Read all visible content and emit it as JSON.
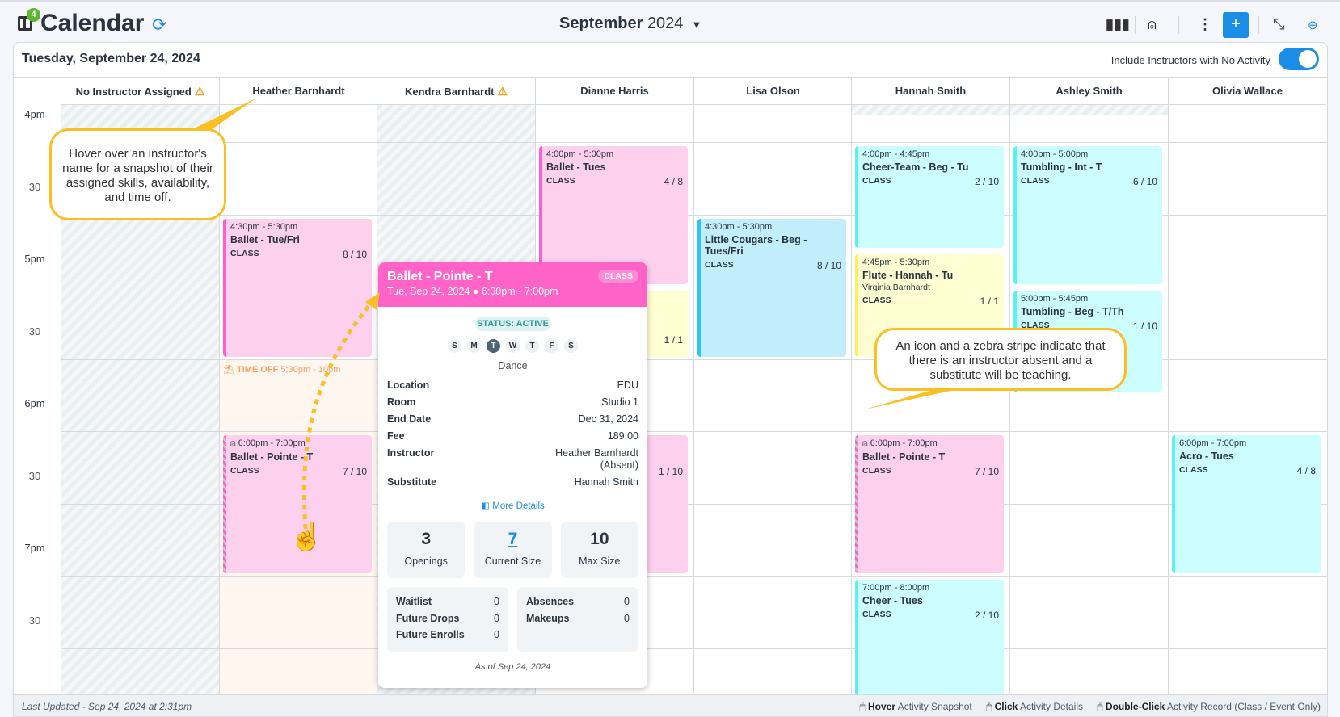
{
  "header": {
    "title": "Calendar",
    "notification_count": "4",
    "month_bold": "September",
    "month_year": "2024"
  },
  "panel": {
    "date": "Tuesday, September 24, 2024",
    "toggle_label": "Include Instructors with No Activity",
    "toggle_on": true
  },
  "instructors": [
    {
      "name": "No Instructor Assigned",
      "warning": true,
      "unavailable": true
    },
    {
      "name": "Heather Barnhardt",
      "warning": false
    },
    {
      "name": "Kendra Barnhardt",
      "warning": true,
      "unavailable": true
    },
    {
      "name": "Dianne Harris",
      "warning": false
    },
    {
      "name": "Lisa Olson",
      "warning": false
    },
    {
      "name": "Hannah Smith",
      "warning": false
    },
    {
      "name": "Ashley Smith",
      "warning": false
    },
    {
      "name": "Olivia Wallace",
      "warning": false
    }
  ],
  "time_labels": [
    "4pm",
    "30",
    "5pm",
    "30",
    "6pm",
    "30",
    "7pm",
    "30"
  ],
  "time_off": {
    "instructor": 1,
    "label": "TIME OFF",
    "time": "5:30pm - 10pm",
    "start": 17.5,
    "end": 22
  },
  "colors": {
    "pink": "#ff5fc8",
    "cyan": "#5cf0f5",
    "yellow": "#ffef5a",
    "blue": "#2cc3f7",
    "accent": "#1a8de6",
    "warning": "#f59a0b"
  },
  "events": [
    {
      "col": 1,
      "start": 16.5,
      "end": 17.5,
      "time": "4:30pm - 5:30pm",
      "name": "Ballet - Tue/Fri",
      "type": "CLASS",
      "count": "8 / 10",
      "color": "pink"
    },
    {
      "col": 1,
      "start": 18,
      "end": 19,
      "time": "6:00pm - 7:00pm",
      "name": "Ballet - Pointe - T",
      "type": "CLASS",
      "count": "7 / 10",
      "color": "pink",
      "substitute": true
    },
    {
      "col": 3,
      "start": 16,
      "end": 17,
      "time": "4:00pm - 5:00pm",
      "name": "Ballet - Tues",
      "type": "CLASS",
      "count": "4 / 8",
      "color": "pink"
    },
    {
      "col": 3,
      "start": 17,
      "end": 17.5,
      "count": "1 / 1",
      "color": "yellow"
    },
    {
      "col": 3,
      "start": 18,
      "end": 19,
      "count": "1 / 10",
      "color": "pink"
    },
    {
      "col": 4,
      "start": 16.5,
      "end": 17.5,
      "time": "4:30pm - 5:30pm",
      "name": "Little Cougars - Beg - Tues/Fri",
      "type": "CLASS",
      "count": "8 / 10",
      "color": "blue"
    },
    {
      "col": 5,
      "start": 16,
      "end": 16.75,
      "time": "4:00pm - 4:45pm",
      "name": "Cheer-Team - Beg - Tu",
      "type": "CLASS",
      "count": "2 / 10",
      "color": "cyan"
    },
    {
      "col": 5,
      "start": 16.75,
      "end": 17.5,
      "time": "4:45pm - 5:30pm",
      "name": "Flute - Hannah - Tu",
      "sub": "Virginia Barnhardt",
      "type": "CLASS",
      "count": "1 / 1",
      "color": "yellow"
    },
    {
      "col": 5,
      "start": 18,
      "end": 19,
      "time": "6:00pm - 7:00pm",
      "name": "Ballet - Pointe - T",
      "type": "CLASS",
      "count": "7 / 10",
      "color": "pink",
      "substitute": true
    },
    {
      "col": 5,
      "start": 19,
      "end": 20,
      "time": "7:00pm - 8:00pm",
      "name": "Cheer - Tues",
      "type": "CLASS",
      "count": "2 / 10",
      "color": "cyan"
    },
    {
      "col": 6,
      "start": 16,
      "end": 17,
      "time": "4:00pm - 5:00pm",
      "name": "Tumbling - Int - T",
      "type": "CLASS",
      "count": "6 / 10",
      "color": "cyan"
    },
    {
      "col": 6,
      "start": 17,
      "end": 17.75,
      "time": "5:00pm - 5:45pm",
      "name": "Tumbling - Beg - T/Th",
      "type": "CLASS",
      "count": "1 / 10",
      "color": "cyan"
    },
    {
      "col": 7,
      "start": 18,
      "end": 19,
      "time": "6:00pm - 7:00pm",
      "name": "Acro - Tues",
      "type": "CLASS",
      "count": "4 / 8",
      "color": "cyan"
    }
  ],
  "popover": {
    "title": "Ballet - Pointe - T",
    "subtitle": "Tue, Sep 24, 2024 ● 6:00pm - 7:00pm",
    "tag": "CLASS",
    "status": "STATUS: ACTIVE",
    "days": [
      "S",
      "M",
      "T",
      "W",
      "T",
      "F",
      "S"
    ],
    "active_day": 2,
    "category": "Dance",
    "details": [
      {
        "k": "Location",
        "v": "EDU"
      },
      {
        "k": "Room",
        "v": "Studio 1"
      },
      {
        "k": "End Date",
        "v": "Dec 31, 2024"
      },
      {
        "k": "Fee",
        "v": "189.00"
      },
      {
        "k": "Instructor",
        "v": "Heather Barnhardt (Absent)"
      },
      {
        "k": "Substitute",
        "v": "Hannah Smith"
      }
    ],
    "more_details": "More Details",
    "stats": [
      {
        "v": "3",
        "l": "Openings"
      },
      {
        "v": "7",
        "l": "Current Size"
      },
      {
        "v": "10",
        "l": "Max Size"
      }
    ],
    "left": [
      {
        "k": "Waitlist",
        "v": "0"
      },
      {
        "k": "Future Drops",
        "v": "0"
      },
      {
        "k": "Future Enrolls",
        "v": "0"
      }
    ],
    "right": [
      {
        "k": "Absences",
        "v": "0"
      },
      {
        "k": "Makeups",
        "v": "0"
      }
    ],
    "as_of": "As of Sep 24, 2024"
  },
  "callouts": {
    "hover": "Hover over an instructor's name for a snapshot of their assigned skills, availability, and time off.",
    "zebra": "An icon and a zebra stripe indicate that there is an instructor absent and a substitute will be teaching."
  },
  "footer": {
    "last_updated": "Last Updated - Sep 24, 2024 at 2:31pm",
    "hint1_b": "Hover",
    "hint1": "Activity Snapshot",
    "hint2_b": "Click",
    "hint2": "Activity Details",
    "hint3_b": "Double-Click",
    "hint3": "Activity Record (Class / Event Only)"
  }
}
